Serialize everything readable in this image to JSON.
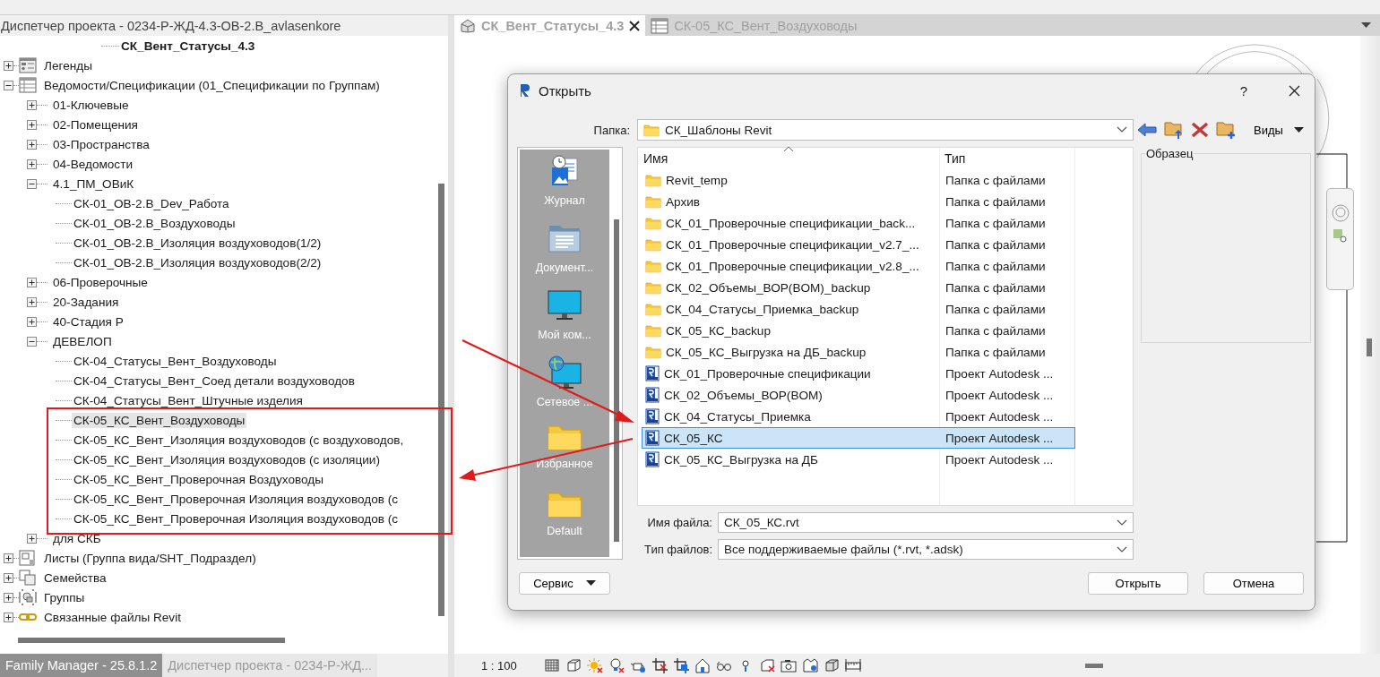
{
  "project_browser": {
    "title": "Диспетчер проекта - 0234-Р-ЖД-4.3-ОВ-2.В_avlasenkore",
    "current_view": "СК_Вент_Статусы_4.3",
    "tree": [
      {
        "label": "Легенды",
        "kind": "legend",
        "expanded": false
      },
      {
        "label": "Ведомости/Спецификации (01_Спецификации по Группам)",
        "kind": "schedule",
        "expanded": true,
        "children": [
          {
            "label": "01-Ключевые",
            "expanded": false
          },
          {
            "label": "02-Помещения",
            "expanded": false
          },
          {
            "label": "03-Пространства",
            "expanded": false
          },
          {
            "label": "04-Ведомости",
            "expanded": false
          },
          {
            "label": "4.1_ПМ_ОВиК",
            "expanded": true,
            "children": [
              {
                "label": "СК-01_ОВ-2.В_Dev_Работа",
                "selected": false
              },
              {
                "label": "СК-01_ОВ-2.В_Воздуховоды",
                "selected": false
              },
              {
                "label": "СК-01_ОВ-2.В_Изоляция воздуховодов(1/2)",
                "selected": false
              },
              {
                "label": "СК-01_ОВ-2.В_Изоляция воздуховодов(2/2)",
                "selected": false
              }
            ]
          },
          {
            "label": "06-Проверочные",
            "expanded": false
          },
          {
            "label": "20-Задания",
            "expanded": false
          },
          {
            "label": "40-Стадия Р",
            "expanded": false
          },
          {
            "label": "ДЕВЕЛОП",
            "expanded": true,
            "children": [
              {
                "label": "СК-04_Статусы_Вент_Воздуховоды",
                "selected": false
              },
              {
                "label": "СК-04_Статусы_Вент_Соед детали воздуховодов",
                "selected": false
              },
              {
                "label": "СК-04_Статусы_Вент_Штучные изделия",
                "selected": false
              },
              {
                "label": "СК-05_КС_Вент_Воздуховоды",
                "selected": true
              },
              {
                "label": "СК-05_КС_Вент_Изоляция воздуховодов (с воздуховодов,",
                "selected": false
              },
              {
                "label": "СК-05_КС_Вент_Изоляция воздуховодов (с изоляции)",
                "selected": false
              },
              {
                "label": "СК-05_КС_Вент_Проверочная Воздуховоды",
                "selected": false
              },
              {
                "label": "СК-05_КС_Вент_Проверочная Изоляция воздуховодов (с",
                "selected": false
              },
              {
                "label": "СК-05_КС_Вент_Проверочная Изоляция воздуховодов (с",
                "selected": false
              }
            ]
          },
          {
            "label": "для СКБ",
            "expanded": false
          }
        ]
      },
      {
        "label": "Листы (Группа вида/SHT_Подраздел)",
        "kind": "sheet",
        "expanded": false
      },
      {
        "label": "Семейства",
        "kind": "family",
        "expanded": false
      },
      {
        "label": "Группы",
        "kind": "group",
        "expanded": false
      },
      {
        "label": "Связанные файлы Revit",
        "kind": "link",
        "expanded": false
      }
    ]
  },
  "bottom_tabs": [
    {
      "label": "Family Manager - 25.8.1.2",
      "selected": false
    },
    {
      "label": "Диспетчер проекта - 0234-Р-ЖД...",
      "selected": true
    }
  ],
  "view_tabs": [
    {
      "label": "СК_Вент_Статусы_4.3",
      "kind": "model",
      "selected": true
    },
    {
      "label": "СК-05_КС_Вент_Воздуховоды",
      "kind": "schedule",
      "selected": false
    }
  ],
  "view_scale": "1 : 100",
  "dialog": {
    "title": "Открыть",
    "help": "?",
    "folder_label": "Папка:",
    "folder": "СК_Шаблоны Revit",
    "views_button": "Виды",
    "places": [
      {
        "label": "Журнал",
        "kind": "history"
      },
      {
        "label": "Документ...",
        "kind": "documents"
      },
      {
        "label": "Мой ком...",
        "kind": "computer"
      },
      {
        "label": "Сетевое ...",
        "kind": "network"
      },
      {
        "label": "Избранное",
        "kind": "folder"
      },
      {
        "label": "Default",
        "kind": "folder"
      }
    ],
    "columns": [
      "Имя",
      "Тип"
    ],
    "files": [
      {
        "name": "Revit_temp",
        "type": "Папка с файлами",
        "kind": "folder",
        "selected": false
      },
      {
        "name": "Архив",
        "type": "Папка с файлами",
        "kind": "folder",
        "selected": false
      },
      {
        "name": "СК_01_Проверочные спецификации_back...",
        "type": "Папка с файлами",
        "kind": "folder",
        "selected": false
      },
      {
        "name": "СК_01_Проверочные спецификации_v2.7_...",
        "type": "Папка с файлами",
        "kind": "folder",
        "selected": false
      },
      {
        "name": "СК_01_Проверочные спецификации_v2.8_...",
        "type": "Папка с файлами",
        "kind": "folder",
        "selected": false
      },
      {
        "name": "СК_02_Объемы_ВОР(BOM)_backup",
        "type": "Папка с файлами",
        "kind": "folder",
        "selected": false
      },
      {
        "name": "СК_04_Статусы_Приемка_backup",
        "type": "Папка с файлами",
        "kind": "folder",
        "selected": false
      },
      {
        "name": "СК_05_КС_backup",
        "type": "Папка с файлами",
        "kind": "folder",
        "selected": false
      },
      {
        "name": "СК_05_КС_Выгрузка на ДБ_backup",
        "type": "Папка с файлами",
        "kind": "folder",
        "selected": false
      },
      {
        "name": "СК_01_Проверочные спецификации",
        "type": "Проект Autodesk ...",
        "kind": "rvt",
        "selected": false
      },
      {
        "name": "СК_02_Объемы_ВОР(BOM)",
        "type": "Проект Autodesk ...",
        "kind": "rvt",
        "selected": false
      },
      {
        "name": "СК_04_Статусы_Приемка",
        "type": "Проект Autodesk ...",
        "kind": "rvt",
        "selected": false
      },
      {
        "name": "СК_05_КС",
        "type": "Проект Autodesk ...",
        "kind": "rvt",
        "selected": true
      },
      {
        "name": "СК_05_КС_Выгрузка на ДБ",
        "type": "Проект Autodesk ...",
        "kind": "rvt",
        "selected": false
      }
    ],
    "preview_label": "Образец",
    "file_name_label": "Имя файла:",
    "file_name": "СК_05_КС.rvt",
    "file_type_label": "Тип файлов:",
    "file_type": "Все поддерживаемые файлы  (*.rvt, *.adsk)",
    "tools_button": "Сервис",
    "open_button": "Открыть",
    "cancel_button": "Отмена"
  }
}
